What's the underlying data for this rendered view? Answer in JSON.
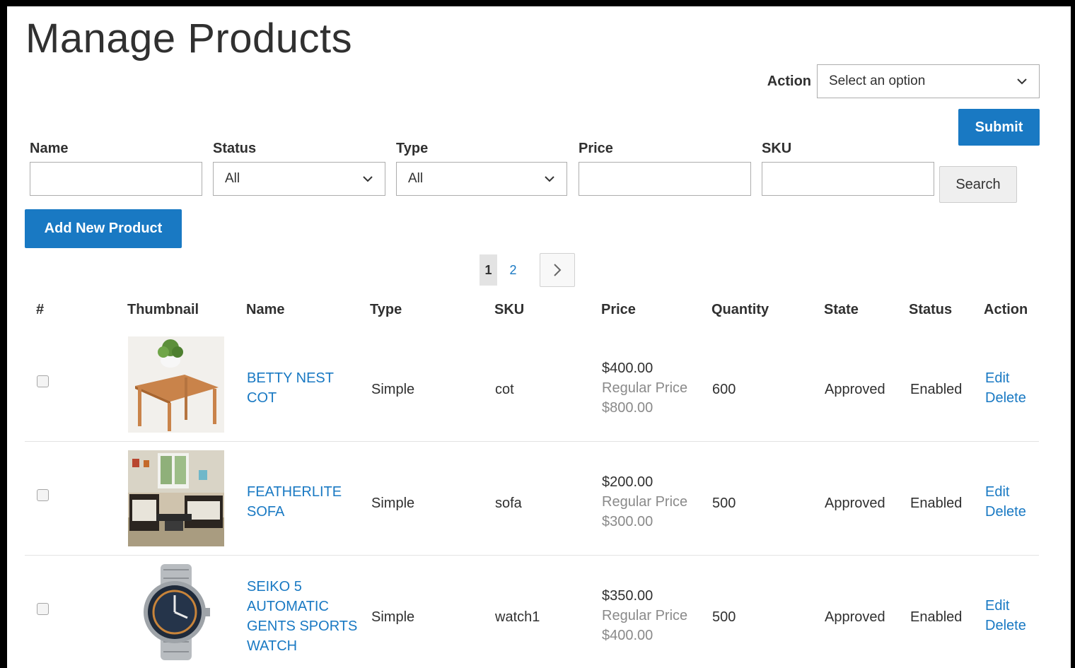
{
  "page": {
    "title": "Manage Products"
  },
  "mass_action": {
    "label": "Action",
    "placeholder": "Select an option",
    "submit_label": "Submit"
  },
  "filters": {
    "name_label": "Name",
    "status_label": "Status",
    "status_value": "All",
    "type_label": "Type",
    "type_value": "All",
    "price_label": "Price",
    "sku_label": "SKU",
    "search_label": "Search"
  },
  "add_button": "Add New Product",
  "pager": {
    "current": "1",
    "next_page": "2"
  },
  "columns": [
    "#",
    "Thumbnail",
    "Name",
    "Type",
    "SKU",
    "Price",
    "Quantity",
    "State",
    "Status",
    "Action"
  ],
  "products": [
    {
      "name_lines": [
        "BETTY NEST",
        "COT"
      ],
      "type": "Simple",
      "sku": "cot",
      "price": "$400.00",
      "regular_label": "Regular Price",
      "regular_price": "$800.00",
      "quantity": "600",
      "state": "Approved",
      "status": "Enabled",
      "edit": "Edit",
      "delete": "Delete",
      "thumb_icon": "table-thumbnail"
    },
    {
      "name_lines": [
        "FEATHERLITE",
        "SOFA"
      ],
      "type": "Simple",
      "sku": "sofa",
      "price": "$200.00",
      "regular_label": "Regular Price",
      "regular_price": "$300.00",
      "quantity": "500",
      "state": "Approved",
      "status": "Enabled",
      "edit": "Edit",
      "delete": "Delete",
      "thumb_icon": "sofa-thumbnail"
    },
    {
      "name_lines": [
        "SEIKO 5",
        "AUTOMATIC",
        "GENTS SPORTS",
        "WATCH"
      ],
      "type": "Simple",
      "sku": "watch1",
      "price": "$350.00",
      "regular_label": "Regular Price",
      "regular_price": "$400.00",
      "quantity": "500",
      "state": "Approved",
      "status": "Enabled",
      "edit": "Edit",
      "delete": "Delete",
      "thumb_icon": "watch-thumbnail"
    }
  ],
  "colors": {
    "primary": "#1979c3",
    "text": "#303030",
    "muted": "#8a8a8a"
  }
}
